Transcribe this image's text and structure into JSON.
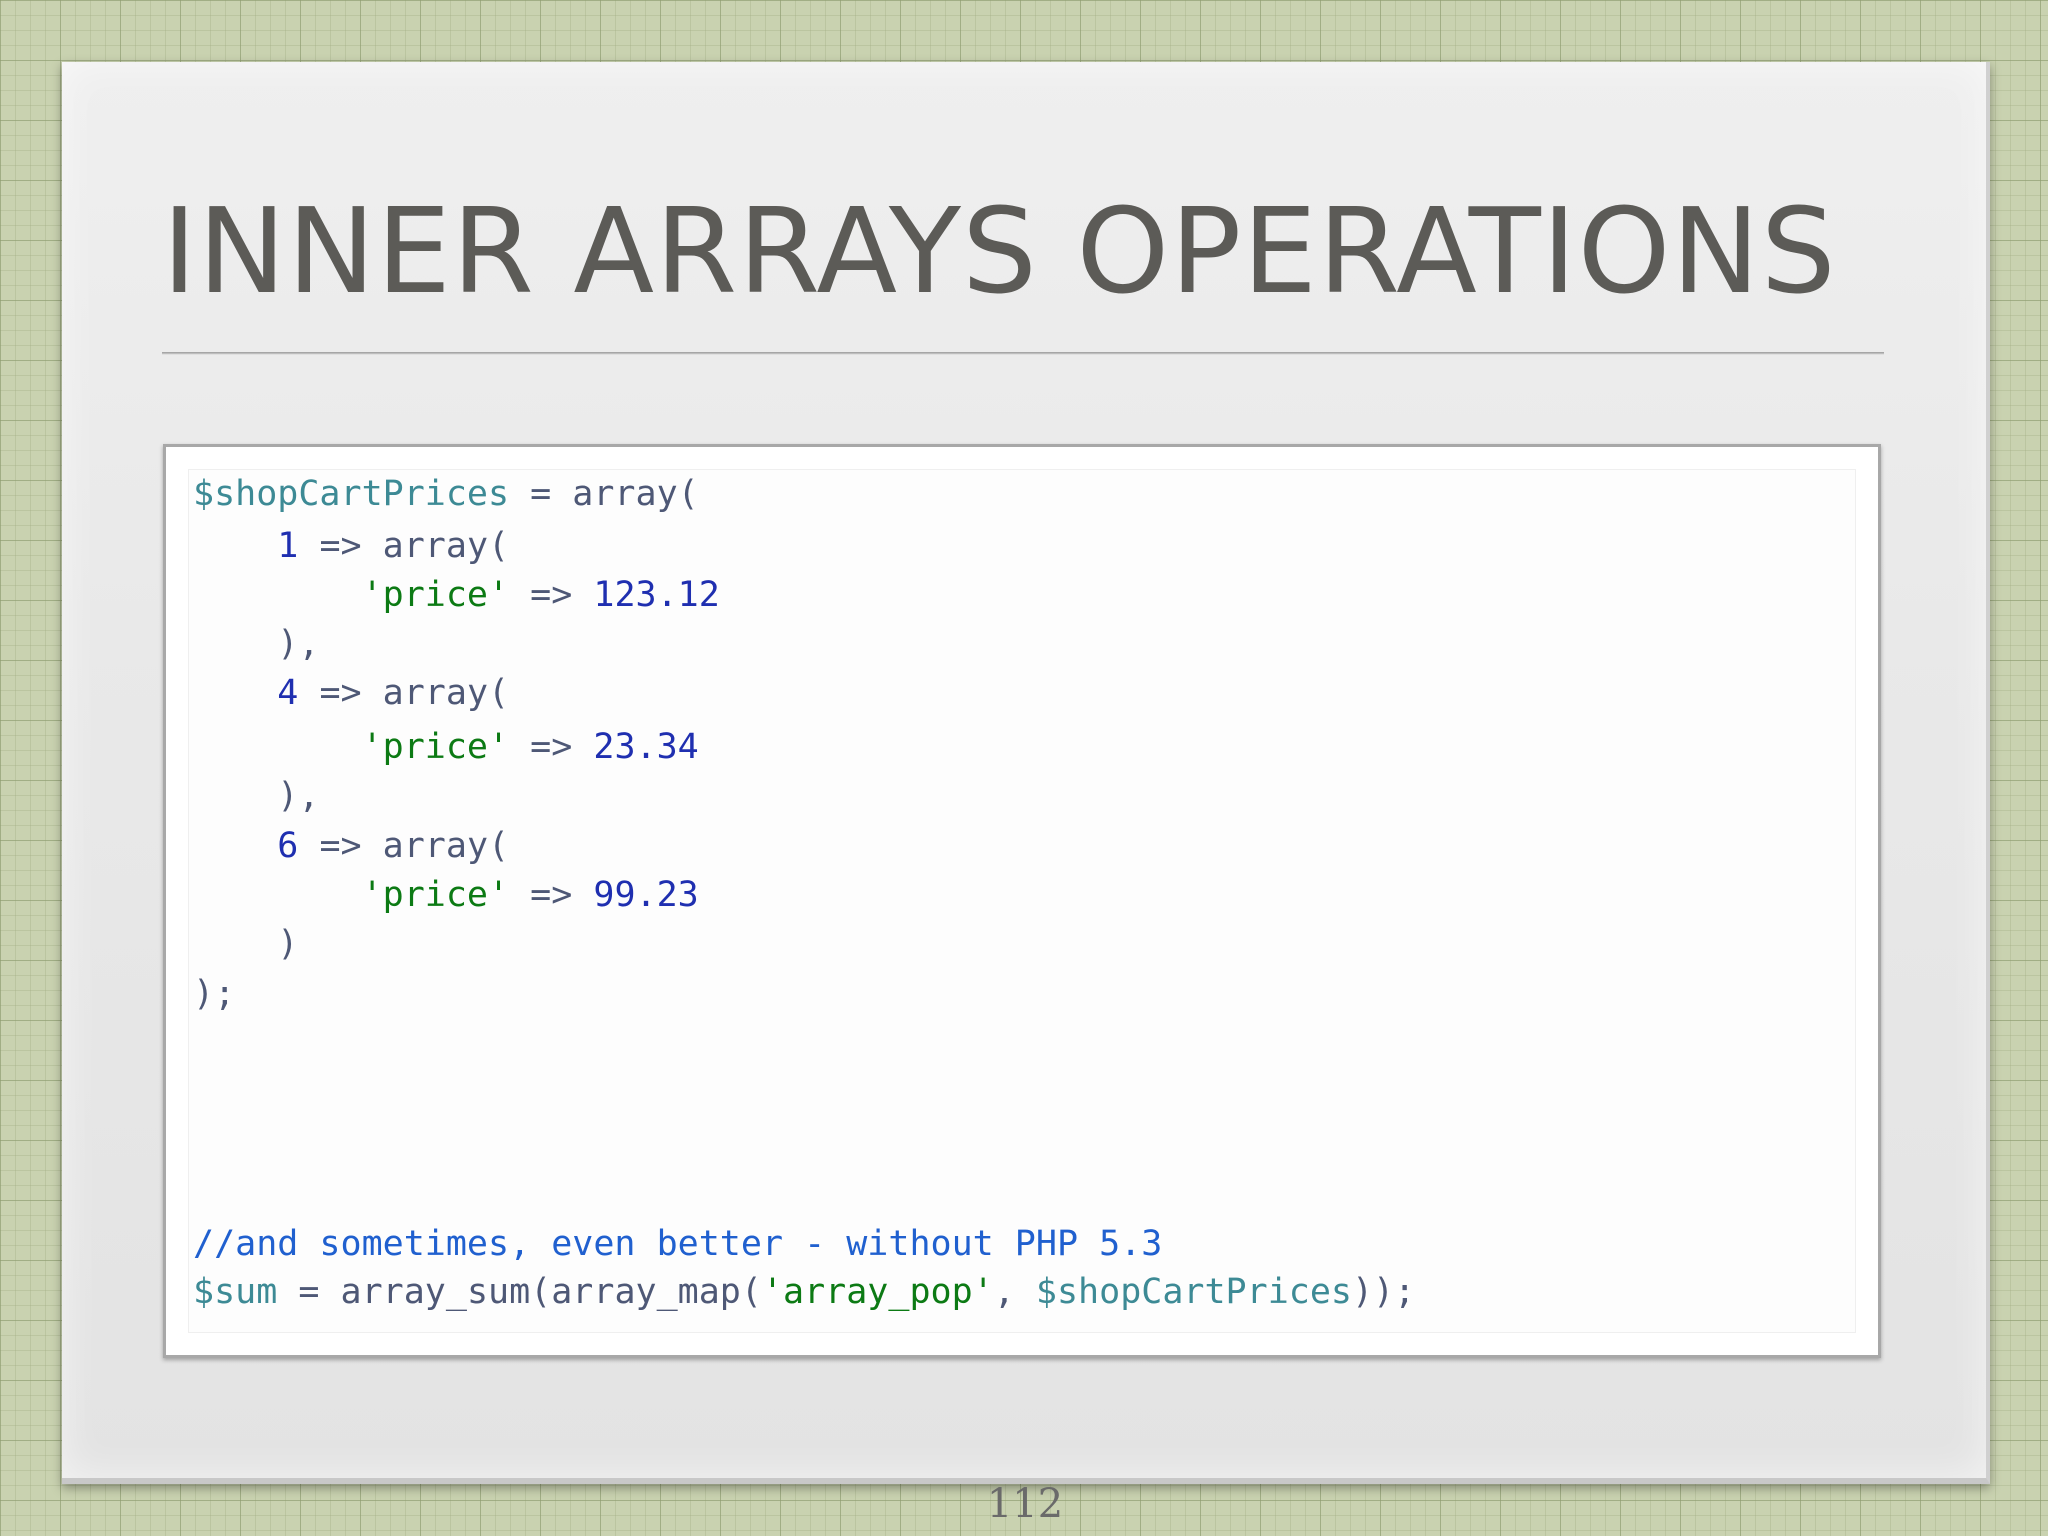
{
  "slide": {
    "title": "INNER ARRAYS OPERATIONS",
    "page_number": "112"
  },
  "code": {
    "lines": [
      [
        {
          "t": "$shopCartPrices",
          "k": "var"
        },
        {
          "t": " = array(",
          "k": "plain"
        }
      ],
      [
        {
          "t": "    ",
          "k": "plain"
        },
        {
          "t": "1",
          "k": "num"
        },
        {
          "t": " => array(",
          "k": "plain"
        }
      ],
      [
        {
          "t": "        ",
          "k": "plain"
        },
        {
          "t": "'price'",
          "k": "str"
        },
        {
          "t": " => ",
          "k": "plain"
        },
        {
          "t": "123.12",
          "k": "num"
        }
      ],
      [
        {
          "t": "    ),",
          "k": "plain"
        }
      ],
      [
        {
          "t": "    ",
          "k": "plain"
        },
        {
          "t": "4",
          "k": "num"
        },
        {
          "t": " => array(",
          "k": "plain"
        }
      ],
      [
        {
          "t": "        ",
          "k": "plain"
        },
        {
          "t": "'price'",
          "k": "str"
        },
        {
          "t": " => ",
          "k": "plain"
        },
        {
          "t": "23.34",
          "k": "num"
        }
      ],
      [
        {
          "t": "    ),",
          "k": "plain"
        }
      ],
      [
        {
          "t": "    ",
          "k": "plain"
        },
        {
          "t": "6",
          "k": "num"
        },
        {
          "t": " => array(",
          "k": "plain"
        }
      ],
      [
        {
          "t": "        ",
          "k": "plain"
        },
        {
          "t": "'price'",
          "k": "str"
        },
        {
          "t": " => ",
          "k": "plain"
        },
        {
          "t": "99.23",
          "k": "num"
        }
      ],
      [
        {
          "t": "    )",
          "k": "plain"
        }
      ],
      [
        {
          "t": ");",
          "k": "plain"
        }
      ],
      [
        {
          "t": "//and sometimes, even better - without PHP 5.3",
          "k": "cmt"
        }
      ],
      [
        {
          "t": "$sum",
          "k": "var"
        },
        {
          "t": " = array_sum(array_map(",
          "k": "plain"
        },
        {
          "t": "'array_pop'",
          "k": "str"
        },
        {
          "t": ", ",
          "k": "plain"
        },
        {
          "t": "$shopCartPrices",
          "k": "var"
        },
        {
          "t": "));",
          "k": "plain"
        }
      ]
    ]
  }
}
